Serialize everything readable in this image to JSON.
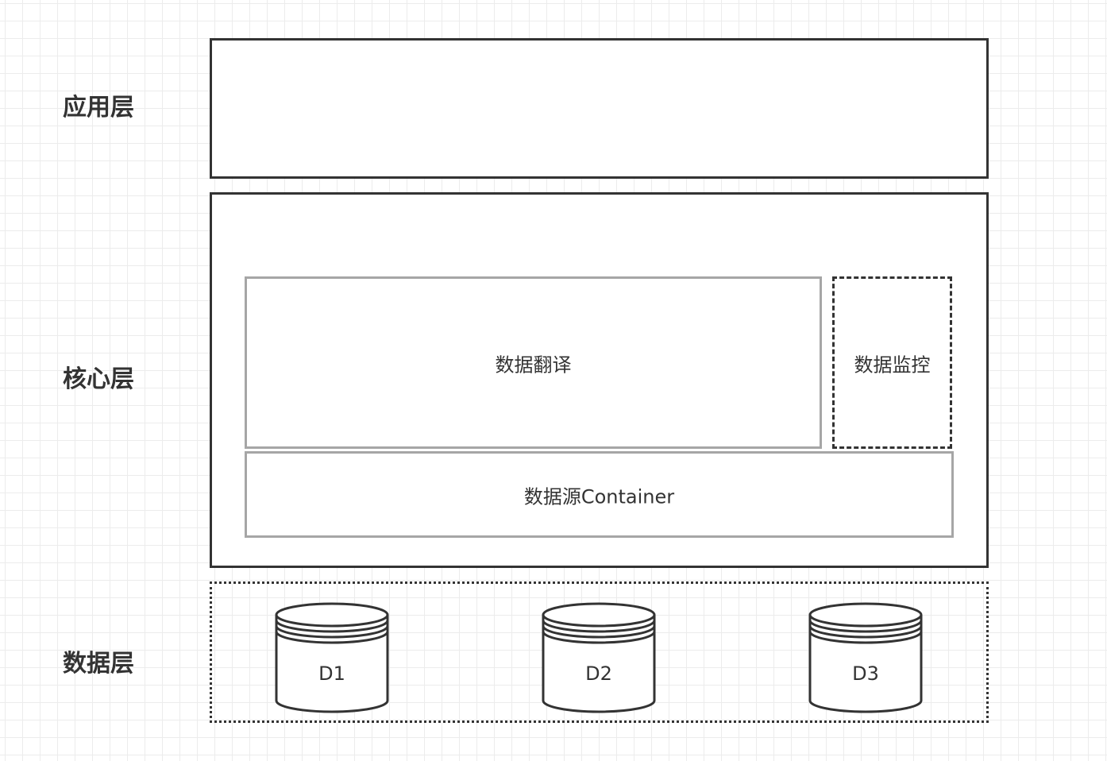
{
  "layers": {
    "application": "应用层",
    "core": "核心层",
    "data": "数据层"
  },
  "core": {
    "translation": "数据翻译",
    "monitor": "数据监控",
    "container": "数据源Container"
  },
  "databases": [
    "D1",
    "D2",
    "D3"
  ]
}
